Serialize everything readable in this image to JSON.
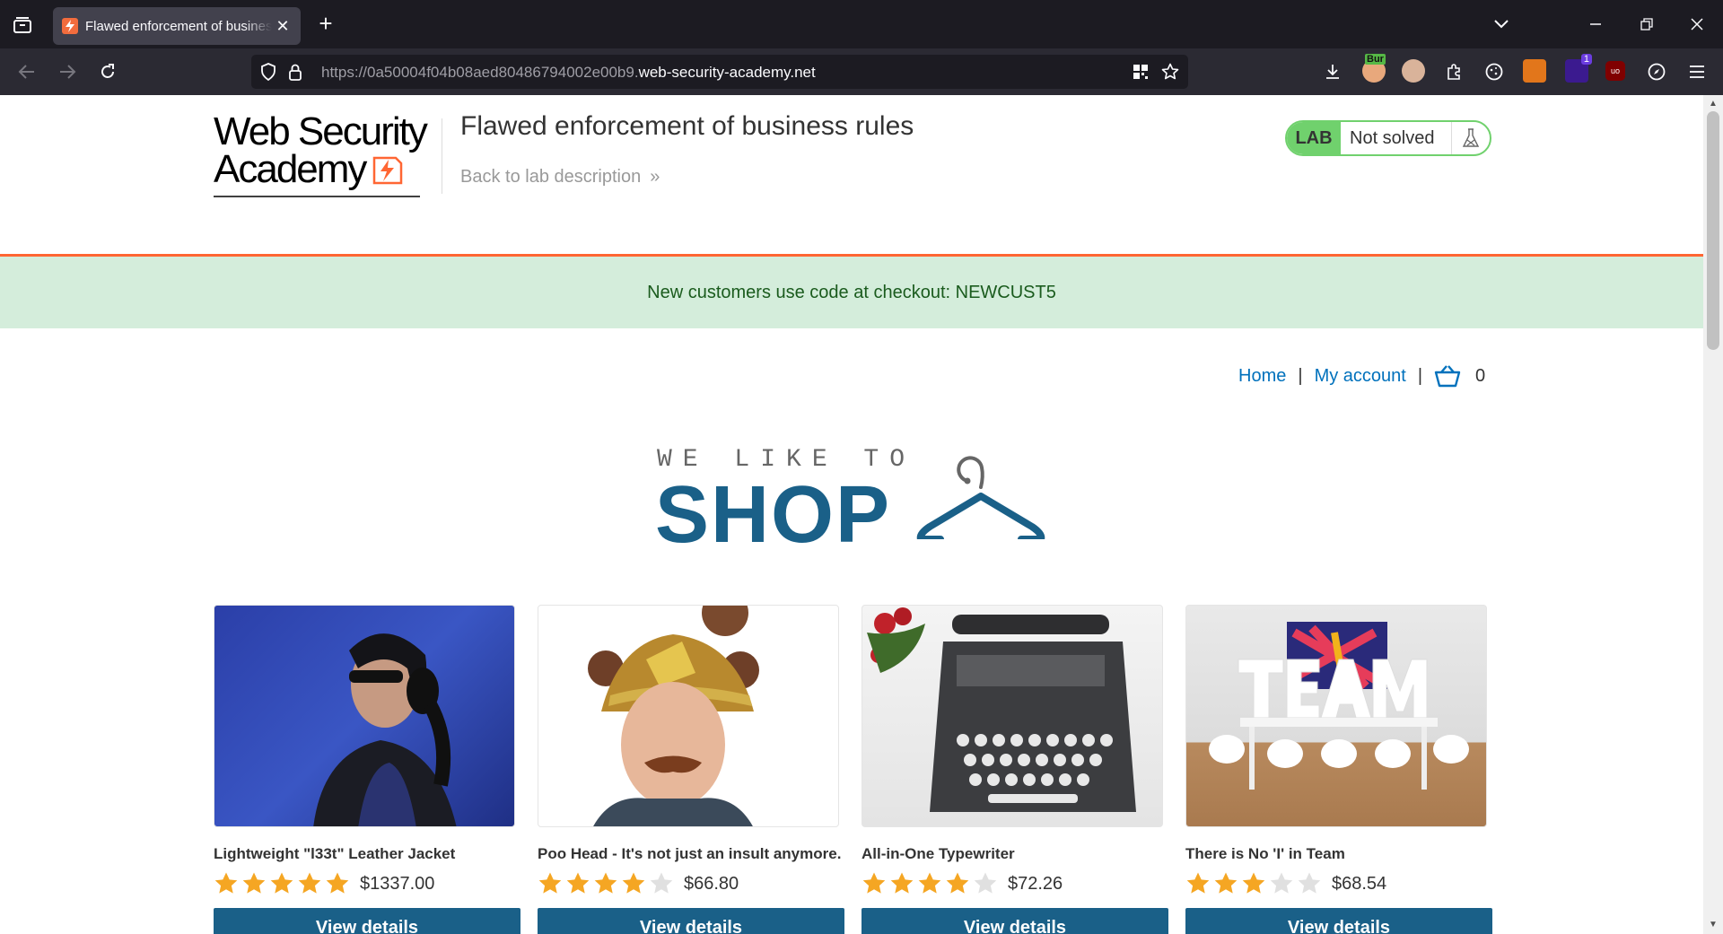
{
  "browser": {
    "tab_title": "Flawed enforcement of business rules",
    "tab_close": "✕",
    "new_tab": "+",
    "url_prefix": "https://0a50004f04b08aed80486794002e00b9.",
    "url_host": "web-security-academy.net",
    "burp_badge": "Bur",
    "ext_badge_count": "1",
    "ublock_label": "uo"
  },
  "header": {
    "logo_line1": "Web Security",
    "logo_line2": "Academy",
    "lab_title": "Flawed enforcement of business rules",
    "back_link": "Back to lab description",
    "back_chevron": "»",
    "lab_badge": "LAB",
    "lab_status": "Not solved"
  },
  "promo": {
    "text": "New customers use code at checkout: NEWCUST5"
  },
  "nav": {
    "home": "Home",
    "separator": "|",
    "my_account": "My account",
    "cart_count": "0"
  },
  "banner": {
    "top_line": "WE LIKE TO",
    "shop": "SHOP"
  },
  "colors": {
    "accent_orange": "#ff6633",
    "lab_green": "#70d16d",
    "promo_bg": "#d4eddb",
    "link_blue": "#0071bc",
    "button_blue": "#1a6088",
    "star_filled": "#f5a623",
    "star_empty": "#e0e0e0"
  },
  "products": [
    {
      "name": "Lightweight \"l33t\" Leather Jacket",
      "rating": 5,
      "price": "$1337.00",
      "button": "View details",
      "image": "woman-with-headphones-photo"
    },
    {
      "name": "Poo Head - It's not just an insult anymore.",
      "rating": 4,
      "price": "$66.80",
      "button": "View details",
      "image": "man-wearing-poo-head-hat-photo"
    },
    {
      "name": "All-in-One Typewriter",
      "rating": 4,
      "price": "$72.26",
      "button": "View details",
      "image": "typewriter-photo"
    },
    {
      "name": "There is No 'I' in Team",
      "rating": 3,
      "price": "$68.54",
      "button": "View details",
      "image": "team-letters-meeting-room-photo"
    }
  ]
}
